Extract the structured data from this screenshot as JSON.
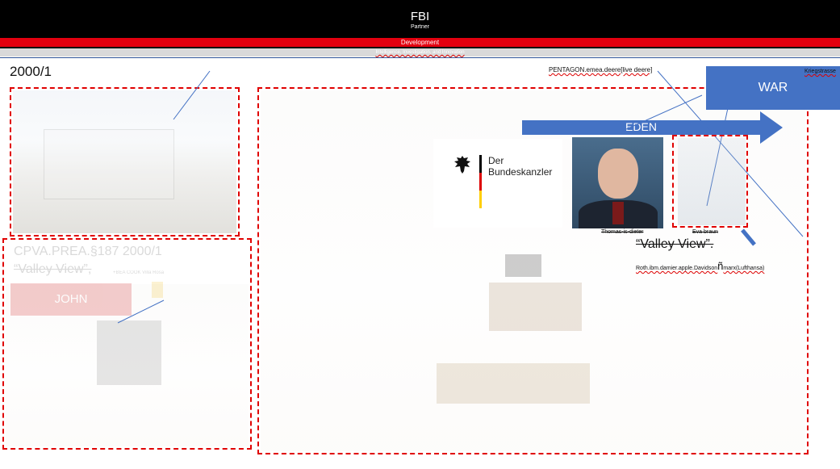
{
  "header": {
    "title": "FBI",
    "subtitle": "Partner",
    "band_label": "Development",
    "grey_text": "Intelligence, Investigation, and Innovation"
  },
  "left": {
    "date": "2000/1",
    "caption_line1": "CPVA.PREA.§187  2000/1",
    "caption_line2": "“Valley View”,",
    "caption_small": "+BEA COOK Villa Rosa",
    "john_label": "JOHN"
  },
  "right": {
    "pentagon_label": "PENTAGON.emea.deere[live deere]",
    "kriegstrasse_label": "Kriegstrasse",
    "war_label": "WAR",
    "eden_label": "EDEN",
    "bundeskanzler_line1": "Der",
    "bundeskanzler_line2": "Bundeskanzler",
    "portrait_caption": "Thomas-is-dieter",
    "eva_caption": "Eva braun",
    "valley_view": "“Valley View”.",
    "roth_line": "Roth.ibm.damier.apple.Davidson",
    "roth_symbol": "ñ",
    "roth_suffix": "marx(Lufthansa)"
  },
  "colors": {
    "header_black": "#000000",
    "band_red": "#e3000f",
    "dashed_red": "#e00000",
    "eden_blue": "#4472c4",
    "war_blue": "#4472c4",
    "john_red": "#d32020"
  }
}
